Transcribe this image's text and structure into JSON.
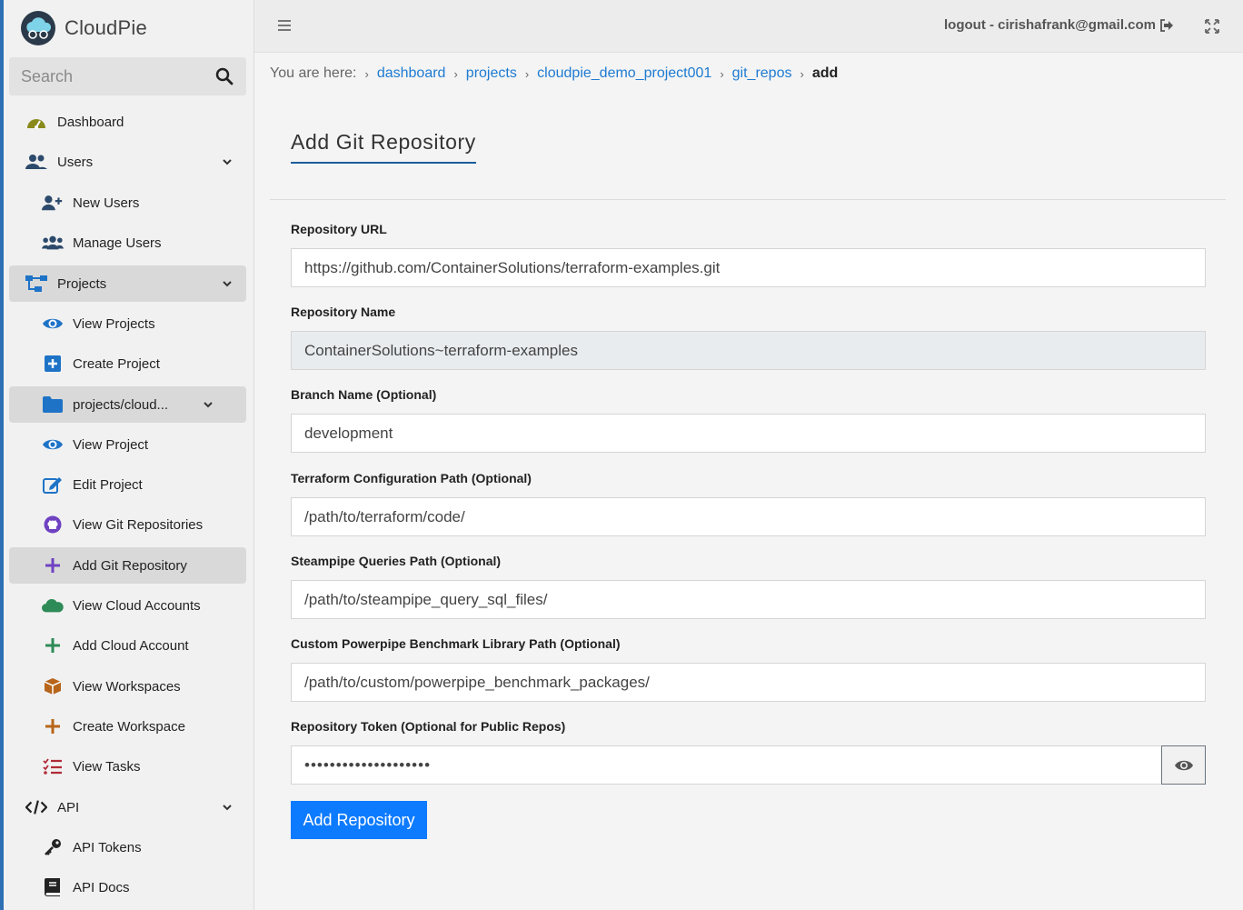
{
  "brand": {
    "name": "CloudPie"
  },
  "search": {
    "placeholder": "Search"
  },
  "sidebar": {
    "items": [
      {
        "label": "Dashboard"
      },
      {
        "label": "Users"
      },
      {
        "label": "New Users"
      },
      {
        "label": "Manage Users"
      },
      {
        "label": "Projects"
      },
      {
        "label": "View Projects"
      },
      {
        "label": "Create Project"
      },
      {
        "label": "projects/cloud..."
      },
      {
        "label": "View Project"
      },
      {
        "label": "Edit Project"
      },
      {
        "label": "View Git Repositories"
      },
      {
        "label": "Add Git Repository"
      },
      {
        "label": "View Cloud Accounts"
      },
      {
        "label": "Add Cloud Account"
      },
      {
        "label": "View Workspaces"
      },
      {
        "label": "Create Workspace"
      },
      {
        "label": "View Tasks"
      },
      {
        "label": "API"
      },
      {
        "label": "API Tokens"
      },
      {
        "label": "API Docs"
      }
    ]
  },
  "topbar": {
    "logout_label": "logout - cirishafrank@gmail.com"
  },
  "breadcrumb": {
    "prefix": "You are here:",
    "items": [
      "dashboard",
      "projects",
      "cloudpie_demo_project001",
      "git_repos"
    ],
    "current": "add"
  },
  "page": {
    "title": "Add Git Repository"
  },
  "form": {
    "repo_url": {
      "label": "Repository URL",
      "value": "https://github.com/ContainerSolutions/terraform-examples.git"
    },
    "repo_name": {
      "label": "Repository Name",
      "value": "ContainerSolutions~terraform-examples"
    },
    "branch": {
      "label": "Branch Name (Optional)",
      "value": "development"
    },
    "tf_path": {
      "label": "Terraform Configuration Path (Optional)",
      "value": "/path/to/terraform/code/"
    },
    "steampipe_path": {
      "label": "Steampipe Queries Path (Optional)",
      "value": "/path/to/steampipe_query_sql_files/"
    },
    "powerpipe_path": {
      "label": "Custom Powerpipe Benchmark Library Path (Optional)",
      "value": "/path/to/custom/powerpipe_benchmark_packages/"
    },
    "token": {
      "label": "Repository Token (Optional for Public Repos)",
      "value": "••••••••••••••••••••"
    },
    "submit_label": "Add Repository"
  },
  "colors": {
    "accent": "#0d7bff",
    "link": "#1e7bd2",
    "sidebar_border": "#2f6fb3"
  }
}
